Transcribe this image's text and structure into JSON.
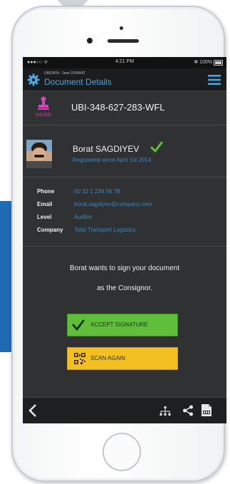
{
  "status_bar": {
    "carrier": "●●●○○ ᯤ",
    "time": "4:21 PM",
    "battery": "✻ 100%"
  },
  "app_bar": {
    "subtitle": "UBIDATA - Jean DURANT",
    "title": "Document Details"
  },
  "document": {
    "status_label": "ISSUED",
    "id": "UBI-348-627-283-WFL"
  },
  "user": {
    "name": "Borat SAGDIYEV",
    "registered": "Registered since April 1st 2014"
  },
  "details": [
    {
      "label": "Phone",
      "value": "00 32 1 234 56 78"
    },
    {
      "label": "Email",
      "value": "borat.sagdiyev@company.com"
    },
    {
      "label": "Level",
      "value": "Auditor"
    },
    {
      "label": "Company",
      "value": "Total Transport Logistics"
    }
  ],
  "message": {
    "line1": "Borat wants to sign your document",
    "line2": "as the Consignor."
  },
  "buttons": {
    "accept": "ACCEPT SIGNATURE",
    "scan": "SCAN AGAIN"
  },
  "icons": {
    "settings": "gear-icon",
    "menu": "hamburger-menu-icon",
    "status": "stamp-icon",
    "verified": "checkmark-icon",
    "accept": "checkmark-icon",
    "scan": "qr-code-icon",
    "back": "chevron-left-icon",
    "network": "network-icon",
    "share": "share-icon",
    "pdf": "pdf-file-icon"
  },
  "colors": {
    "accent_blue": "#3d86c6",
    "title_blue": "#4da6e0",
    "issued_magenta": "#d14ab3",
    "accept_green": "#5fbf3a",
    "scan_yellow": "#f2c021",
    "screen_bg": "#2f3133"
  }
}
